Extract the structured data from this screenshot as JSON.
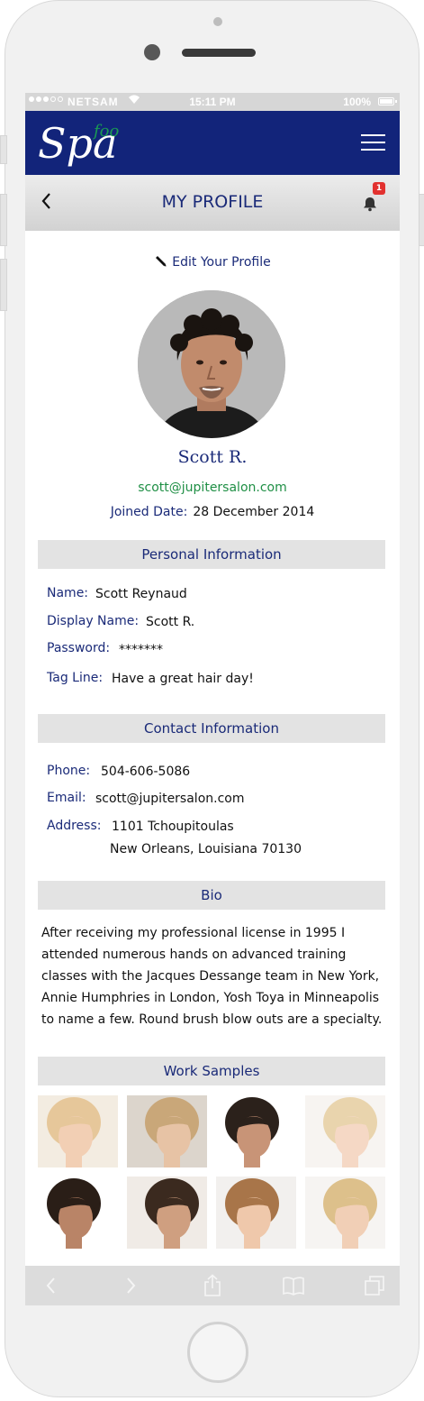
{
  "status_bar": {
    "carrier": "NETSAM",
    "time": "15:11 PM",
    "battery": "100%"
  },
  "app": {
    "logo_main": "Spa",
    "logo_small": "foo"
  },
  "titlebar": {
    "title": "MY PROFILE",
    "notification_count": "1"
  },
  "profile": {
    "edit_link": "Edit Your Profile",
    "name": "Scott R.",
    "email": "scott@jupitersalon.com",
    "joined_label": "Joined Date:",
    "joined_value": "28 December 2014"
  },
  "personal": {
    "header": "Personal Information",
    "name_label": "Name:",
    "name_value": "Scott Reynaud",
    "display_label": "Display Name:",
    "display_value": "Scott R.",
    "password_label": "Password:",
    "password_value": "*******",
    "tagline_label": "Tag Line:",
    "tagline_value": "Have a great hair day!"
  },
  "contact": {
    "header": "Contact Information",
    "phone_label": "Phone:",
    "phone_value": "504-606-5086",
    "email_label": "Email:",
    "email_value": "scott@jupitersalon.com",
    "address_label": "Address:",
    "address_line1": "1101 Tchoupitoulas",
    "address_line2": "New Orleans, Louisiana  70130"
  },
  "bio": {
    "header": "Bio",
    "text": "After receiving my professional license in 1995 I attended numerous hands on advanced training classes with the Jacques Dessange  team in New York, Annie Humphries in London, Yosh Toya in Minneapolis to name a few. Round brush blow outs are a specialty."
  },
  "work_samples": {
    "header": "Work Samples",
    "items": [
      {
        "kind": "blonde-headband-updo",
        "bg": "#f3ece1",
        "hair": "#e6c79a",
        "skin": "#f2cfb4"
      },
      {
        "kind": "blonde-twist-updo",
        "bg": "#dcd5cc",
        "hair": "#c9a779",
        "skin": "#e7c3a5"
      },
      {
        "kind": "dark-beard-fade",
        "bg": "#ffffff",
        "hair": "#2b211b",
        "skin": "#c89477"
      },
      {
        "kind": "blonde-pixie-child",
        "bg": "#f7f4f1",
        "hair": "#e9d4ad",
        "skin": "#f5d8c5"
      },
      {
        "kind": "dark-curly-man",
        "bg": "#ffffff",
        "hair": "#2a1e17",
        "skin": "#b98467"
      },
      {
        "kind": "pompadour-man",
        "bg": "#f0ebe6",
        "hair": "#3b2a1f",
        "skin": "#cf9f80"
      },
      {
        "kind": "caramel-bob-woman",
        "bg": "#f2f0ee",
        "hair": "#a87549",
        "skin": "#efc8ab"
      },
      {
        "kind": "blonde-bangs-woman",
        "bg": "#f6f4f2",
        "hair": "#ddc08b",
        "skin": "#f1cfb6"
      }
    ]
  },
  "icons": {
    "back": "chevron-left-icon",
    "menu": "hamburger-icon",
    "notifications": "bell-icon",
    "edit": "pencil-icon",
    "toolbar": [
      "chevron-left-icon",
      "chevron-right-icon",
      "share-icon",
      "book-icon",
      "tabs-icon"
    ]
  },
  "colors": {
    "brand_navy": "#12247a",
    "accent_green": "#1f8f45",
    "badge_red": "#e2312f"
  }
}
